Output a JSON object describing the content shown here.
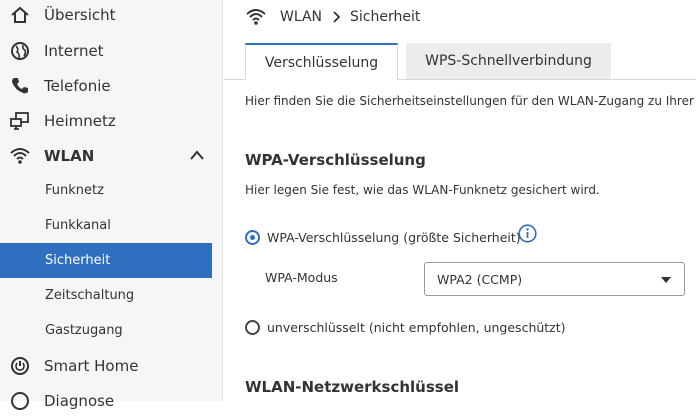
{
  "sidebar": {
    "items": [
      {
        "label": "Übersicht",
        "icon": "home-icon"
      },
      {
        "label": "Internet",
        "icon": "globe-icon"
      },
      {
        "label": "Telefonie",
        "icon": "phone-icon"
      },
      {
        "label": "Heimnetz",
        "icon": "network-icon"
      },
      {
        "label": "WLAN",
        "icon": "wifi-icon"
      },
      {
        "label": "Funknetz"
      },
      {
        "label": "Funkkanal"
      },
      {
        "label": "Sicherheit"
      },
      {
        "label": "Zeitschaltung"
      },
      {
        "label": "Gastzugang"
      },
      {
        "label": "Smart Home",
        "icon": "power-icon"
      },
      {
        "label": "Diagnose",
        "icon": "diagnose-icon"
      }
    ]
  },
  "breadcrumb": {
    "section": "WLAN",
    "page": "Sicherheit"
  },
  "tabs": [
    {
      "label": "Verschlüsselung"
    },
    {
      "label": "WPS-Schnellverbindung"
    }
  ],
  "intro": "Hier finden Sie die Sicherheitseinstellungen für den WLAN-Zugang zu Ihrer F",
  "wpa": {
    "heading": "WPA-Verschlüsselung",
    "description": "Hier legen Sie fest, wie das WLAN-Funknetz gesichert wird.",
    "option_wpa": "WPA-Verschlüsselung (größte Sicherheit)",
    "mode_label": "WPA-Modus",
    "mode_value": "WPA2 (CCMP)",
    "option_none": "unverschlüsselt (nicht empfohlen, ungeschützt)"
  },
  "key_section": {
    "heading": "WLAN-Netzwerkschlüssel"
  },
  "colors": {
    "accent": "#2f6fc0"
  }
}
